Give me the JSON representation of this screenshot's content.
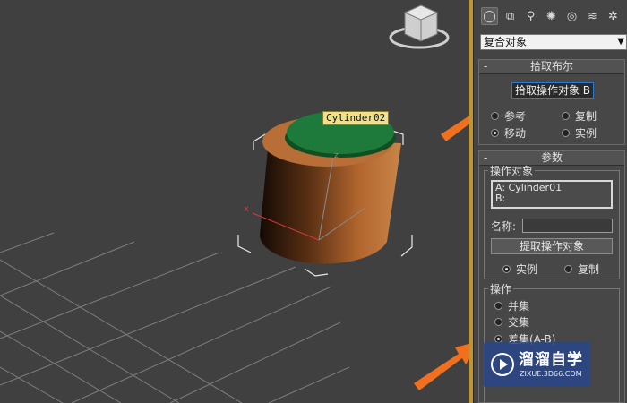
{
  "viewport": {
    "object_label": "Cylinder02",
    "tripod": {
      "x_label": "x",
      "z_label": "z"
    }
  },
  "command_panel": {
    "tabs": [
      {
        "icon": "create-icon",
        "glyph": "◯",
        "active": true
      },
      {
        "icon": "modify-icon",
        "glyph": "⧉",
        "active": false
      },
      {
        "icon": "hierarchy-icon",
        "glyph": "⚲",
        "active": false
      },
      {
        "icon": "motion-icon",
        "glyph": "✺",
        "active": false
      },
      {
        "icon": "display-icon",
        "glyph": "◎",
        "active": false
      },
      {
        "icon": "utilities-icon",
        "glyph": "≋",
        "active": false
      },
      {
        "icon": "extras-icon",
        "glyph": "✲",
        "active": false
      }
    ],
    "category_value": "复合对象",
    "pick_boolean": {
      "title": "拾取布尔",
      "collapse": "-",
      "pick_button": "拾取操作对象 B",
      "options": {
        "reference": "参考",
        "copy": "复制",
        "move": "移动",
        "instance": "实例"
      },
      "selected": "move"
    },
    "parameters": {
      "title": "参数",
      "collapse": "-",
      "operands_label": "操作对象",
      "operand_a": "A: Cylinder01",
      "operand_b": "B:",
      "name_label": "名称:",
      "name_value": "",
      "extract_button": "提取操作对象",
      "extract_options": {
        "instance": "实例",
        "copy": "复制"
      },
      "extract_selected": "instance",
      "operation_label": "操作",
      "operations": {
        "union": "并集",
        "intersection": "交集",
        "subtraction_ab": "差集(A-B)"
      },
      "operation_selected": "subtraction_ab"
    }
  },
  "watermark": {
    "title": "溜溜自学",
    "subtitle": "ZIXUE.3D66.COM"
  },
  "colors": {
    "accent_arrow": "#f07020",
    "cylinder_body": "#a05a2a",
    "cylinder_top": "#1e7a3a",
    "panel_divider": "#c09430"
  }
}
